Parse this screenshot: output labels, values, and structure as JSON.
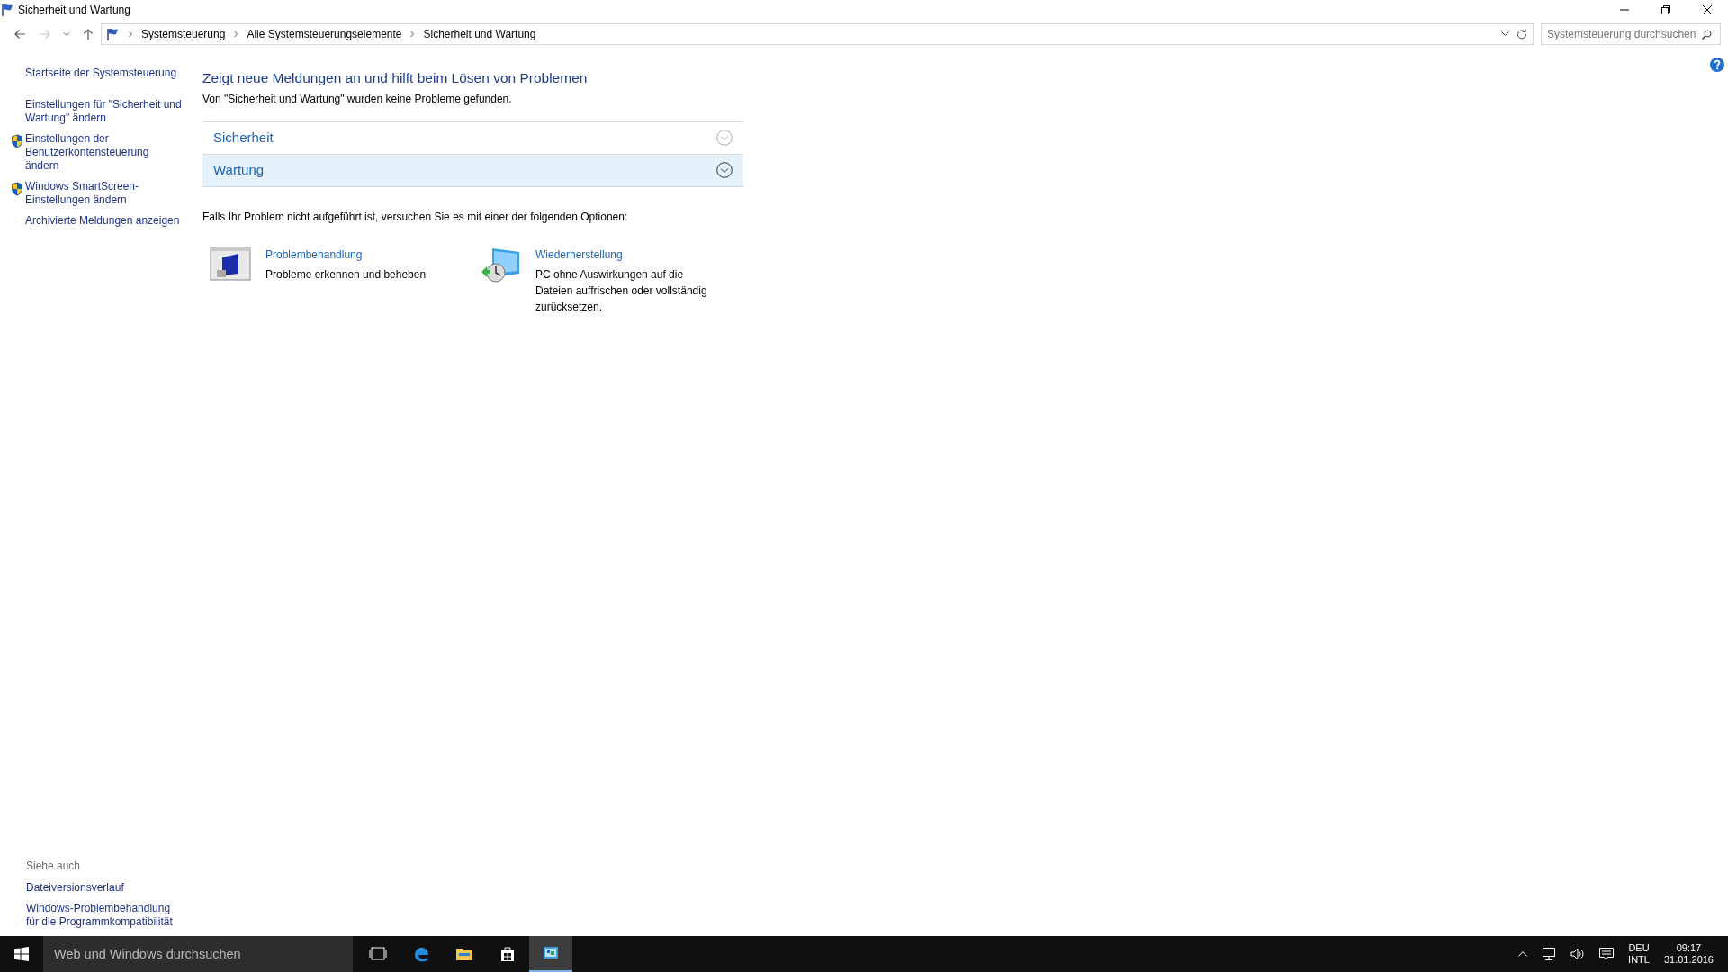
{
  "window": {
    "title": "Sicherheit und Wartung"
  },
  "nav_buttons": [
    {
      "kind": "back",
      "disabled": false
    },
    {
      "kind": "forward",
      "disabled": true
    },
    {
      "kind": "recent",
      "disabled": false
    },
    {
      "kind": "up",
      "disabled": false
    }
  ],
  "breadcrumb": [
    "Systemsteuerung",
    "Alle Systemsteuerungselemente",
    "Sicherheit und Wartung"
  ],
  "search": {
    "placeholder": "Systemsteuerung durchsuchen"
  },
  "sidebar": {
    "links": [
      {
        "text": "Startseite der Systemsteuerung",
        "kind": "plain"
      },
      {
        "text": "Einstellungen für \"Sicherheit und Wartung\" ändern",
        "kind": "plain"
      },
      {
        "text": "Einstellungen der Benutzerkontensteuerung ändern",
        "kind": "shield"
      },
      {
        "text": "Windows SmartScreen-Einstellungen ändern",
        "kind": "shield"
      },
      {
        "text": "Archivierte Meldungen anzeigen",
        "kind": "plain"
      }
    ],
    "see_also": {
      "heading": "Siehe auch",
      "links": [
        "Dateiversionsverlauf",
        "Windows-Problembehandlung für die Programmkompatibilität"
      ]
    }
  },
  "main": {
    "heading": "Zeigt neue Meldungen an und hilft beim Lösen von Problemen",
    "status": "Von \"Sicherheit und Wartung\" wurden keine Probleme gefunden.",
    "sections": [
      {
        "label": "Sicherheit",
        "selected": false
      },
      {
        "label": "Wartung",
        "selected": true
      }
    ],
    "options_intro": "Falls Ihr Problem nicht aufgeführt ist, versuchen Sie es mit einer der folgenden Optionen:",
    "options": [
      {
        "kind": "troubleshoot",
        "title": "Problembehandlung",
        "description": "Probleme erkennen und beheben"
      },
      {
        "kind": "recovery",
        "title": "Wiederherstellung",
        "description": "PC ohne Auswirkungen auf die Dateien auffrischen oder vollständig zurücksetzen."
      }
    ]
  },
  "taskbar": {
    "search_placeholder": "Web und Windows durchsuchen",
    "apps": [
      {
        "kind": "taskview",
        "selected": false
      },
      {
        "kind": "edge",
        "selected": false
      },
      {
        "kind": "explorer",
        "selected": false
      },
      {
        "kind": "store",
        "selected": false
      },
      {
        "kind": "controlpanel",
        "selected": true
      }
    ],
    "language": [
      "DEU",
      "INTL"
    ],
    "time": "09:17",
    "date": "31.01.2016"
  }
}
